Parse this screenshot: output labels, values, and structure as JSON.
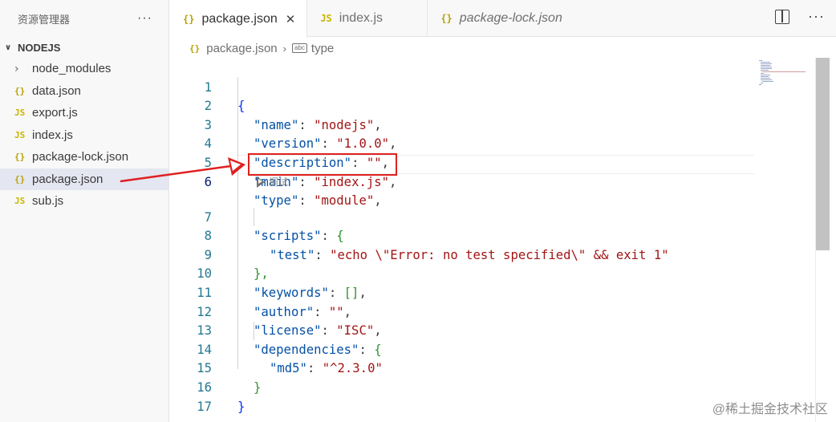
{
  "sidebar": {
    "title": "资源管理器",
    "more": "···",
    "folder": {
      "chevron": "∨",
      "label": "NODEJS"
    },
    "items": [
      {
        "icon": "chevron-right-icon",
        "glyph": "›",
        "label": "node_modules",
        "kind": "chev"
      },
      {
        "icon": "json-file-icon",
        "glyph": "{}",
        "label": "data.json",
        "kind": "json"
      },
      {
        "icon": "js-file-icon",
        "glyph": "JS",
        "label": "export.js",
        "kind": "js"
      },
      {
        "icon": "js-file-icon",
        "glyph": "JS",
        "label": "index.js",
        "kind": "js"
      },
      {
        "icon": "json-file-icon",
        "glyph": "{}",
        "label": "package-lock.json",
        "kind": "json"
      },
      {
        "icon": "json-file-icon",
        "glyph": "{}",
        "label": "package.json",
        "kind": "json",
        "selected": true
      },
      {
        "icon": "js-file-icon",
        "glyph": "JS",
        "label": "sub.js",
        "kind": "js"
      }
    ]
  },
  "tabs": [
    {
      "icon_glyph": "{}",
      "label": "package.json",
      "close": "✕",
      "active": true
    },
    {
      "icon_glyph": "JS",
      "label": "index.js"
    },
    {
      "icon_glyph": "{}",
      "label": "package-lock.json",
      "italic": true
    }
  ],
  "breadcrumb": {
    "icon_glyph": "{}",
    "file": "package.json",
    "sep": "›",
    "symbol_badge": "abc",
    "symbol": "type"
  },
  "codelens": "调试",
  "code": {
    "line_numbers": [
      "1",
      "2",
      "3",
      "4",
      "5",
      "6",
      "7",
      "8",
      "9",
      "10",
      "11",
      "12",
      "13",
      "14",
      "15",
      "16",
      "17"
    ],
    "l1": "{",
    "name_k": "\"name\"",
    "name_v": "\"nodejs\"",
    "version_k": "\"version\"",
    "version_v": "\"1.0.0\"",
    "description_k": "\"description\"",
    "description_v": "\"\"",
    "main_k": "\"main\"",
    "main_v": "\"index.js\"",
    "type_k": "\"type\"",
    "type_v": "\"module\"",
    "scripts_k": "\"scripts\"",
    "open_brace": "{",
    "test_k": "\"test\"",
    "test_v": "\"echo \\\"Error: no test specified\\\" && exit 1\"",
    "close_brace_comma": "},",
    "keywords_k": "\"keywords\"",
    "keywords_v": "[]",
    "author_k": "\"author\"",
    "author_v": "\"\"",
    "license_k": "\"license\"",
    "license_v": "\"ISC\"",
    "dependencies_k": "\"dependencies\"",
    "md5_k": "\"md5\"",
    "md5_v": "\"^2.3.0\"",
    "close_inner": "}",
    "close_outer": "}",
    "colon": ": ",
    "comma": ","
  },
  "annotation": {
    "box_color": "#e02020",
    "arrow_color": "#e02020"
  },
  "watermark": "@稀土掘金技术社区"
}
